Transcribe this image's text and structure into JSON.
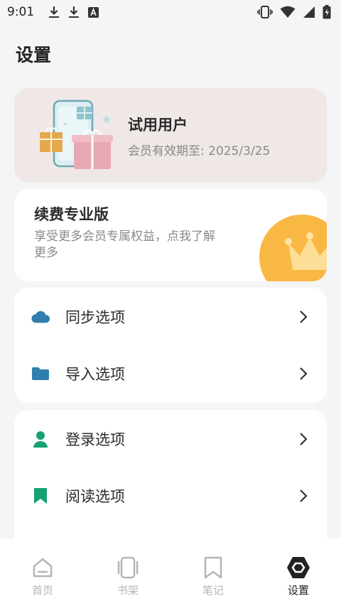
{
  "status_bar": {
    "time": "9:01",
    "icons": [
      "download-icon",
      "download-icon",
      "font-icon",
      "vibrate-icon",
      "wifi-icon",
      "signal-icon",
      "battery-icon"
    ]
  },
  "page": {
    "title": "设置"
  },
  "member": {
    "name": "试用用户",
    "expiry": "会员有效期至: 2025/3/25"
  },
  "renew": {
    "title": "续费专业版",
    "description": "享受更多会员专属权益，点我了解更多",
    "accent_color": "#f9b844"
  },
  "menu_group_1": [
    {
      "label": "同步选项",
      "icon": "cloud-icon",
      "color": "#2f7fae"
    },
    {
      "label": "导入选项",
      "icon": "folder-icon",
      "color": "#2f7fae"
    }
  ],
  "menu_group_2": [
    {
      "label": "登录选项",
      "icon": "user-icon",
      "color": "#17a074"
    },
    {
      "label": "阅读选项",
      "icon": "bookmark-icon",
      "color": "#17a074"
    }
  ],
  "bottom_nav": [
    {
      "label": "首页",
      "icon": "home-icon",
      "active": false
    },
    {
      "label": "书架",
      "icon": "bookshelf-icon",
      "active": false
    },
    {
      "label": "笔记",
      "icon": "bookmark-outline-icon",
      "active": false
    },
    {
      "label": "设置",
      "icon": "settings-hexagon-icon",
      "active": true
    }
  ]
}
